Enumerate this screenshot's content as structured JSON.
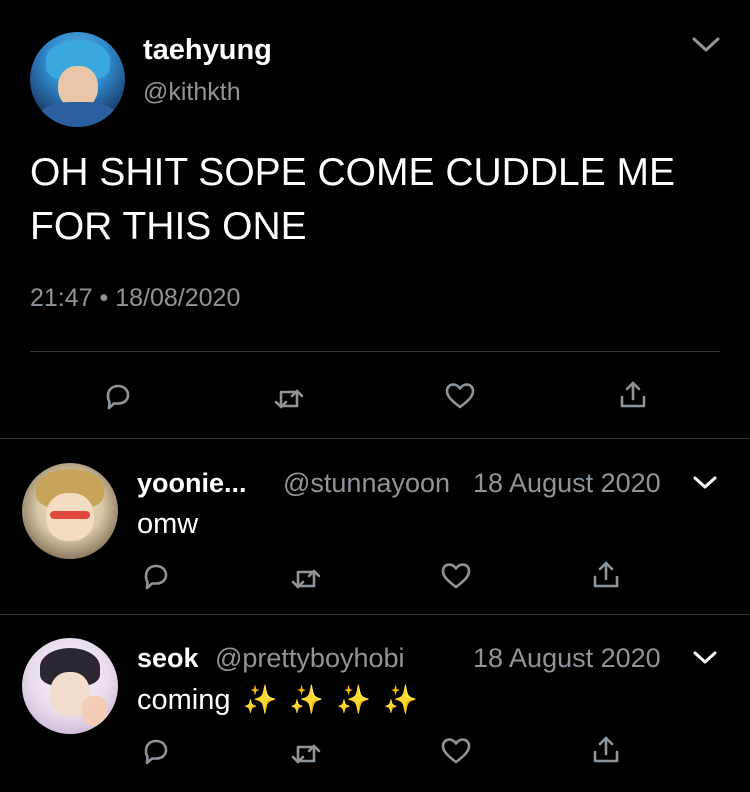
{
  "main_tweet": {
    "name": "taehyung",
    "handle": "@kithkth",
    "text_line1": "OH SHIT SOPE COME CUDDLE ME",
    "text_line2": "FOR THIS ONE",
    "time": "21:47",
    "separator": "•",
    "date": "18/08/2020",
    "actions": [
      "reply-icon",
      "retweet-icon",
      "like-icon",
      "share-icon"
    ]
  },
  "replies": [
    {
      "name": "yoonie...",
      "handle": "@stunnayoon",
      "date": "18 August 2020",
      "text": "omw",
      "emoji": []
    },
    {
      "name": "seok",
      "handle": "@prettyboyhobi",
      "date": "18 August 2020",
      "text": "coming",
      "emoji": [
        "✨",
        "✨",
        "✨",
        "✨"
      ]
    }
  ],
  "colors": {
    "background": "#000000",
    "text_primary": "#ffffff",
    "text_secondary": "#8d959c",
    "divider": "#2f3336"
  }
}
